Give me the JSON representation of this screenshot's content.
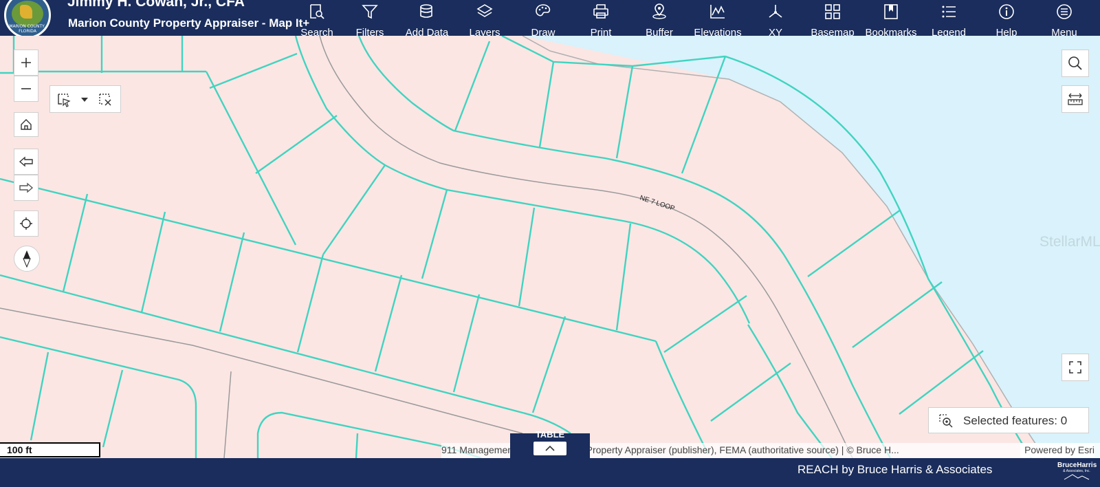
{
  "header": {
    "title": "Jimmy H. Cowan, Jr., CFA",
    "subtitle": "Marion County Property Appraiser - Map It+",
    "logo_text": "MARION COUNTY, FLORIDA",
    "tools": [
      {
        "label": "Search",
        "icon": "search-document-icon"
      },
      {
        "label": "Filters",
        "icon": "filter-icon"
      },
      {
        "label": "Add Data",
        "icon": "database-add-icon"
      },
      {
        "label": "Layers",
        "icon": "layers-icon"
      },
      {
        "label": "Draw",
        "icon": "palette-icon"
      },
      {
        "label": "Print",
        "icon": "printer-icon"
      },
      {
        "label": "Buffer",
        "icon": "buffer-pin-icon"
      },
      {
        "label": "Elevations",
        "icon": "elevation-chart-icon"
      },
      {
        "label": "XY",
        "icon": "xy-axes-icon"
      },
      {
        "label": "Basemap",
        "icon": "grid-squares-icon"
      },
      {
        "label": "Bookmarks",
        "icon": "bookmark-icon"
      },
      {
        "label": "Legend",
        "icon": "list-icon"
      },
      {
        "label": "Help",
        "icon": "info-icon"
      },
      {
        "label": "Menu",
        "icon": "hamburger-icon"
      }
    ]
  },
  "map": {
    "road_label": "NE 7 LOOP",
    "scale_label": "100 ft",
    "attribution": "911 Management, Marion County Property Appraiser (publisher), FEMA (authoritative source) | © Bruce H...",
    "powered_by": "Powered by Esri",
    "watermark": "StellarMLS",
    "selected_features": "Selected features: 0",
    "table_tab": "TABLE",
    "colors": {
      "parcel_fill": "#fbe6e4",
      "parcel_line": "#40d4c0",
      "water": "#d9f2fb",
      "road_center": "#9a9a9a",
      "header_bg": "#1a2d5c"
    }
  },
  "footer": {
    "text": "REACH by Bruce Harris & Associates",
    "brand": "BruceHarris",
    "brand_sub": "& Associates, Inc."
  }
}
